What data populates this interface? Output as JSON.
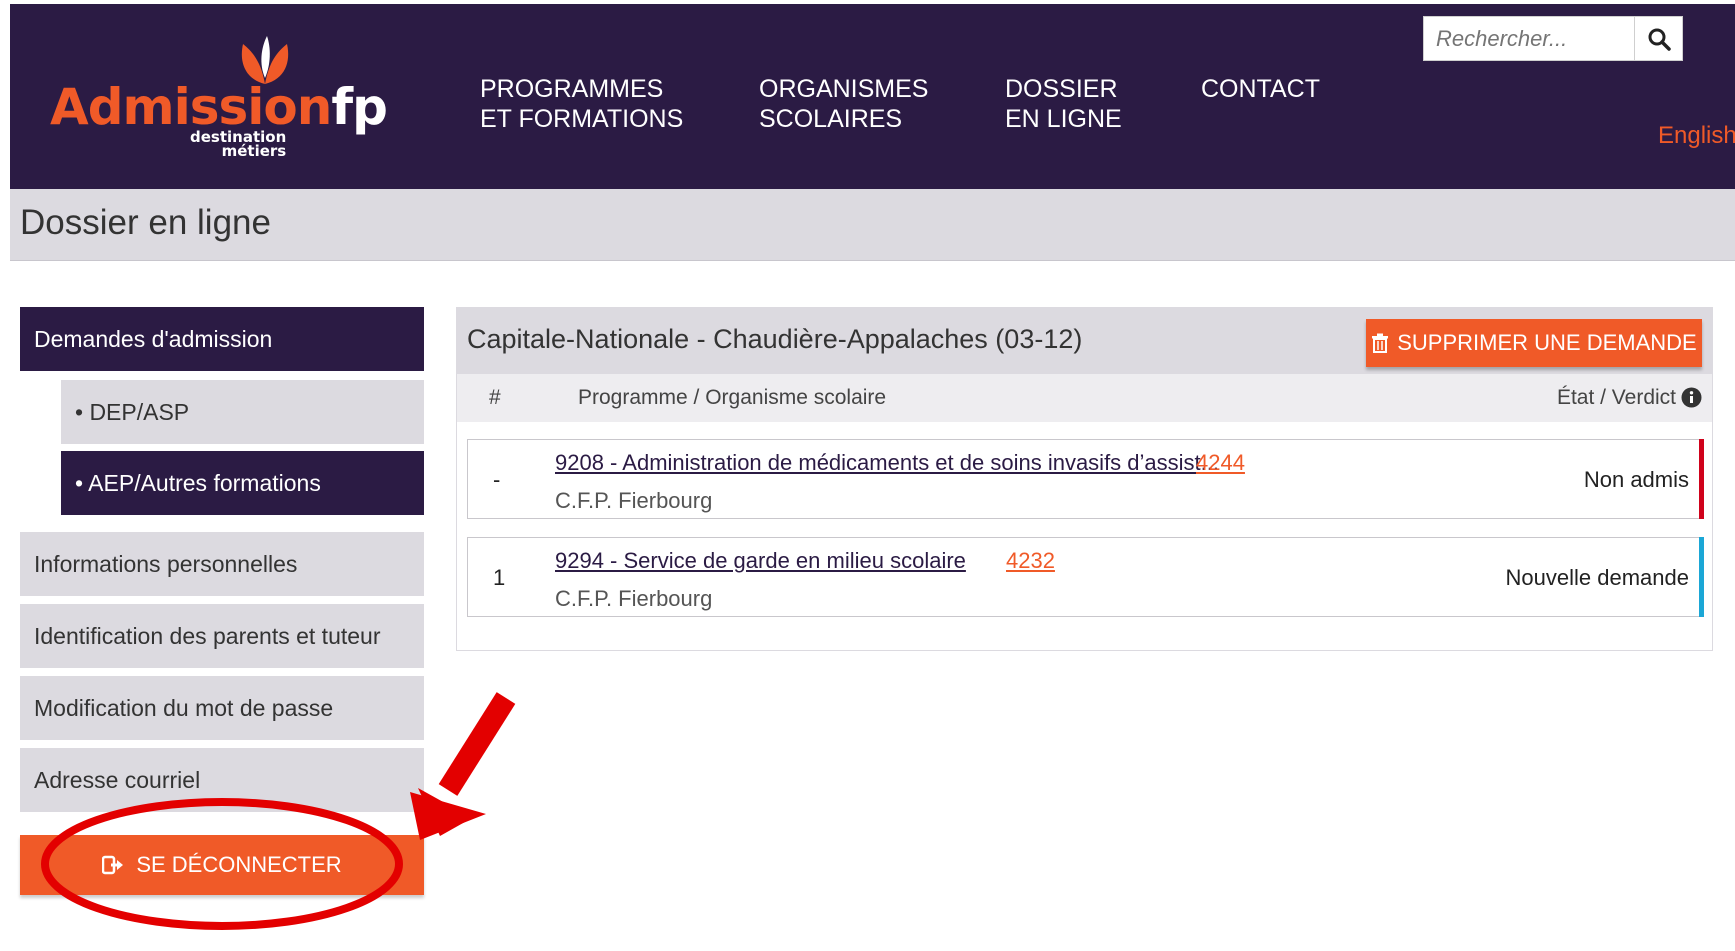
{
  "header": {
    "logo": {
      "main": "Admission",
      "accent": "fp",
      "sub_line1": "destination",
      "sub_line2": "métiers"
    },
    "nav": [
      {
        "line1": "PROGRAMMES",
        "line2": "ET FORMATIONS"
      },
      {
        "line1": "ORGANISMES",
        "line2": "SCOLAIRES"
      },
      {
        "line1": "DOSSIER",
        "line2": "EN LIGNE"
      },
      {
        "line1": "CONTACT",
        "line2": ""
      }
    ],
    "search": {
      "placeholder": "Rechercher..."
    },
    "language_link": "English"
  },
  "page": {
    "title": "Dossier en ligne"
  },
  "sidebar": {
    "items": [
      {
        "label": "Demandes d'admission"
      },
      {
        "label": "• DEP/ASP"
      },
      {
        "label": "• AEP/Autres formations"
      },
      {
        "label": "Informations personnelles"
      },
      {
        "label": "Identification des parents et tuteur"
      },
      {
        "label": "Modification du mot de passe"
      },
      {
        "label": "Adresse courriel"
      }
    ],
    "logout_label": "SE DÉCONNECTER"
  },
  "main": {
    "region_title": "Capitale-Nationale - Chaudière-Appalaches (03-12)",
    "delete_button": "SUPPRIMER UNE DEMANDE",
    "columns": {
      "num": "#",
      "program": "Programme / Organisme scolaire",
      "status": "État / Verdict"
    },
    "rows": [
      {
        "num": "-",
        "program": "9208 - Administration de médicaments et de soins invasifs d’assist...",
        "code": "4244",
        "org": "C.F.P. Fierbourg",
        "status": "Non admis",
        "stripe_color": "#d0021b"
      },
      {
        "num": "1",
        "program": "9294 - Service de garde en milieu scolaire",
        "code": "4232",
        "org": "C.F.P. Fierbourg",
        "status": "Nouvelle demande",
        "stripe_color": "#1ba7d6"
      }
    ]
  },
  "colors": {
    "brand_dark": "#2b1b44",
    "brand_orange": "#f05a28",
    "annotation_red": "#e30000"
  }
}
